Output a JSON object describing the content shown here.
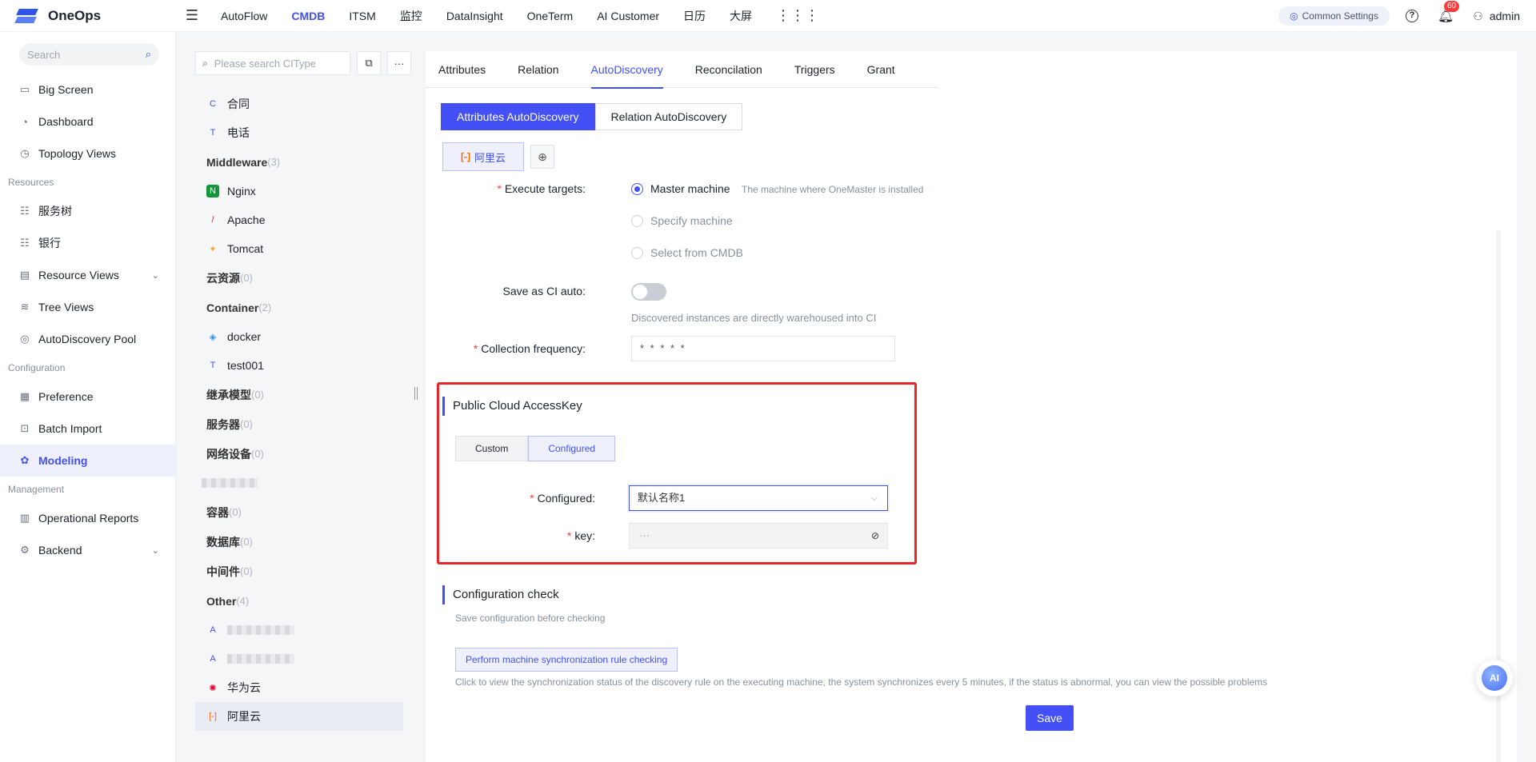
{
  "app": {
    "name": "OneOps"
  },
  "topnav": {
    "items": [
      "AutoFlow",
      "CMDB",
      "ITSM",
      "监控",
      "DataInsight",
      "OneTerm",
      "AI Customer",
      "日历",
      "大屏"
    ],
    "active": "CMDB",
    "common_settings": "Common Settings",
    "notification_count": "60",
    "user": "admin"
  },
  "sidebar": {
    "search_placeholder": "Search",
    "top_items": [
      "Big Screen",
      "Dashboard",
      "Topology Views"
    ],
    "groups": {
      "resources": "Resources",
      "configuration": "Configuration",
      "management": "Management"
    },
    "resource_items": [
      "服务树",
      "银行",
      "Resource Views",
      "Tree Views",
      "AutoDiscovery Pool"
    ],
    "configuration_items": [
      "Preference",
      "Batch Import",
      "Modeling"
    ],
    "management_items": [
      "Operational Reports",
      "Backend"
    ],
    "active": "Modeling"
  },
  "tree": {
    "search_placeholder": "Please search CIType",
    "rows": [
      {
        "type": "item",
        "icon": "C",
        "label": "合同"
      },
      {
        "type": "item",
        "icon": "T",
        "label": "电话"
      },
      {
        "type": "group",
        "label": "Middleware",
        "count": "(3)"
      },
      {
        "type": "item",
        "icon": "nginx",
        "label": "Nginx"
      },
      {
        "type": "item",
        "icon": "feather",
        "label": "Apache"
      },
      {
        "type": "item",
        "icon": "cat",
        "label": "Tomcat"
      },
      {
        "type": "group",
        "label": "云资源",
        "count": "(0)"
      },
      {
        "type": "group",
        "label": "Container",
        "count": "(2)"
      },
      {
        "type": "item",
        "icon": "docker",
        "label": "docker"
      },
      {
        "type": "item",
        "icon": "T",
        "label": "test001"
      },
      {
        "type": "group",
        "label": "继承模型",
        "count": "(0)"
      },
      {
        "type": "group",
        "label": "服务器",
        "count": "(0)"
      },
      {
        "type": "group",
        "label": "网络设备",
        "count": "(0)"
      },
      {
        "type": "blurred",
        "label": ""
      },
      {
        "type": "group",
        "label": "容器",
        "count": "(0)"
      },
      {
        "type": "group",
        "label": "数据库",
        "count": "(0)"
      },
      {
        "type": "group",
        "label": "中间件",
        "count": "(0)"
      },
      {
        "type": "group",
        "label": "Other",
        "count": "(4)"
      },
      {
        "type": "blurred-item",
        "icon": "A",
        "label": ""
      },
      {
        "type": "blurred-item",
        "icon": "A",
        "label": ""
      },
      {
        "type": "item",
        "icon": "huawei",
        "label": "华为云"
      },
      {
        "type": "item",
        "icon": "aliyun",
        "label": "阿里云",
        "active": true
      }
    ]
  },
  "tabs": [
    "Attributes",
    "Relation",
    "AutoDiscovery",
    "Reconcilation",
    "Triggers",
    "Grant"
  ],
  "active_tab": "AutoDiscovery",
  "discovery_mode": {
    "options": [
      "Attributes AutoDiscovery",
      "Relation AutoDiscovery"
    ],
    "active": "Attributes AutoDiscovery"
  },
  "provider_tag": "阿里云",
  "form": {
    "execute_targets_label": "Execute targets",
    "execute_options": [
      "Master machine",
      "Specify machine",
      "Select from CMDB"
    ],
    "execute_selected": "Master machine",
    "master_hint": "The machine where OneMaster is installed",
    "save_as_ci_label": "Save as CI auto",
    "save_as_ci_enabled": false,
    "save_as_ci_hint": "Discovered instances are directly warehoused into CI",
    "collection_frequency_label": "Collection frequency",
    "collection_frequency_value": "* * * * *"
  },
  "accesskey": {
    "title": "Public Cloud AccessKey",
    "modes": [
      "Custom",
      "Configured"
    ],
    "active_mode": "Configured",
    "configured_label": "Configured",
    "configured_value": "默认名称1",
    "key_label": "key",
    "key_value": "···"
  },
  "config_check": {
    "title": "Configuration check",
    "subtitle": "Save configuration before checking",
    "button": "Perform machine synchronization rule checking",
    "description": "Click to view the synchronization status of the discovery rule on the executing machine, the system synchronizes every 5 minutes, if the status is abnormal, you can view the possible problems"
  },
  "save_label": "Save",
  "ai_label": "AI"
}
